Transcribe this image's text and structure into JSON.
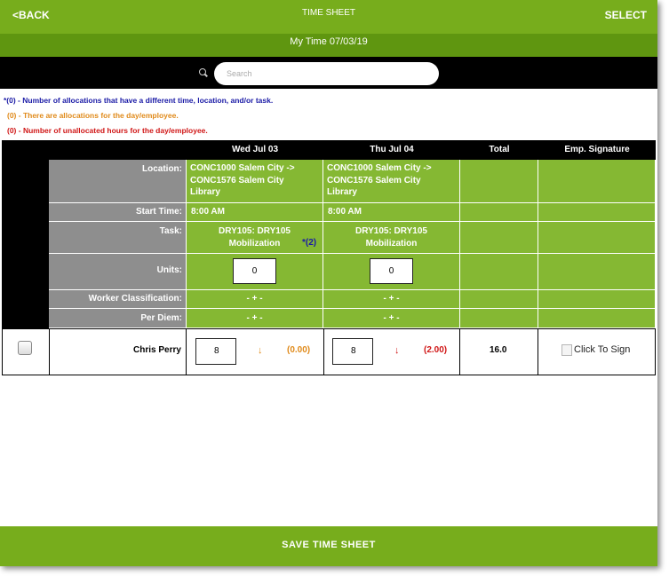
{
  "header": {
    "back": "<BACK",
    "title": "TIME SHEET",
    "select": "SELECT"
  },
  "subheader": {
    "title": "My Time 07/03/19"
  },
  "search": {
    "placeholder": "Search",
    "icon": "search-icon"
  },
  "legend": [
    {
      "text": "*(0) - Number of allocations that have a different time, location, and/or task.",
      "color": "#1a1aa6"
    },
    {
      "text": "(0) - There are allocations for the day/employee.",
      "color": "#e08a1a"
    },
    {
      "text": "(0) - Number of unallocated hours for the day/employee.",
      "color": "#d01616"
    }
  ],
  "table": {
    "columns": [
      "Wed Jul 03",
      "Thu Jul 04",
      "Total",
      "Emp. Signature"
    ],
    "row_labels": {
      "location": "Location:",
      "start_time": "Start Time:",
      "task": "Task:",
      "units": "Units:",
      "worker_classification": "Worker Classification:",
      "per_diem": "Per Diem:"
    },
    "days": [
      {
        "location": [
          "CONC1000 Salem City ->",
          "CONC1576 Salem City",
          "Library"
        ],
        "start_time": "8:00 AM",
        "task": [
          "DRY105: DRY105",
          "Mobilization"
        ],
        "task_flag": "*(2)",
        "units": "0",
        "worker_classification": "- + -",
        "per_diem": "- + -"
      },
      {
        "location": [
          "CONC1000 Salem City ->",
          "CONC1576 Salem City",
          "Library"
        ],
        "start_time": "8:00 AM",
        "task": [
          "DRY105: DRY105",
          "Mobilization"
        ],
        "task_flag": "",
        "units": "0",
        "worker_classification": "- + -",
        "per_diem": "- + -"
      }
    ],
    "employee": {
      "name": "Chris Perry",
      "hours": [
        {
          "value": "8",
          "arrow": "↓",
          "diff": "(0.00)",
          "color": "#e08a1a"
        },
        {
          "value": "8",
          "arrow": "↓",
          "diff": "(2.00)",
          "color": "#d01616"
        }
      ],
      "total": "16.0",
      "signature": "Click To Sign"
    }
  },
  "footer": {
    "save": "SAVE TIME SHEET"
  },
  "colors": {
    "header": "#77ad1c",
    "subheader": "#5f9610",
    "cell_green": "#85b833",
    "cell_gray": "#8e8e8e"
  }
}
